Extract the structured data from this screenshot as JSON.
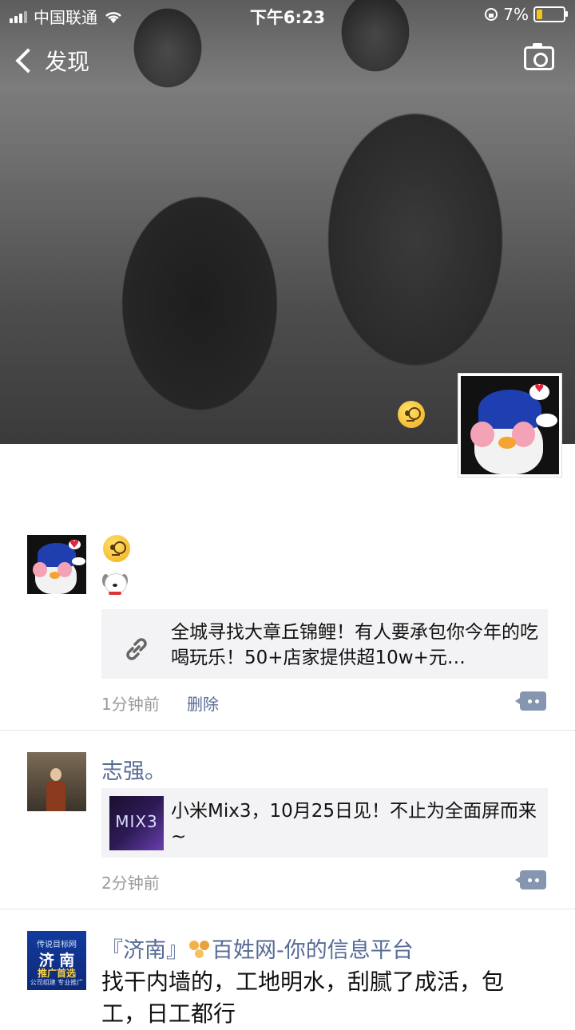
{
  "status_bar": {
    "carrier": "中国联通",
    "time": "下午6:23",
    "battery": "7%"
  },
  "nav": {
    "back_label": "发现"
  },
  "posts": [
    {
      "type": "link",
      "link_text": "全城寻找大章丘锦鲤！有人要承包你今年的吃喝玩乐！50+店家提供超10w+元…",
      "time": "1分钟前",
      "delete_label": "删除"
    },
    {
      "type": "link",
      "name": "志强。",
      "thumb_label": "MIX3",
      "link_text": "小米Mix3，10月25日见！不止为全面屏而来~",
      "time": "2分钟前"
    },
    {
      "type": "text",
      "name_prefix": "『济南』",
      "name_suffix": "百姓网-你的信息平台",
      "avatar_text": [
        "传说目标网",
        "济 南",
        "推广首选",
        "公司组建 专业推广"
      ],
      "text": "找干内墙的，工地明水，刮腻了成活，包工，日工都行"
    }
  ],
  "colors": {
    "link_blue": "#576b95",
    "card_bg": "#f3f3f5",
    "meta_gray": "#9a9a9a"
  },
  "icons": [
    "signal-icon",
    "wifi-icon",
    "battery-icon",
    "back-chevron-icon",
    "camera-icon",
    "link-icon",
    "comment-icon",
    "monocle-emoji",
    "dog-emoji"
  ]
}
